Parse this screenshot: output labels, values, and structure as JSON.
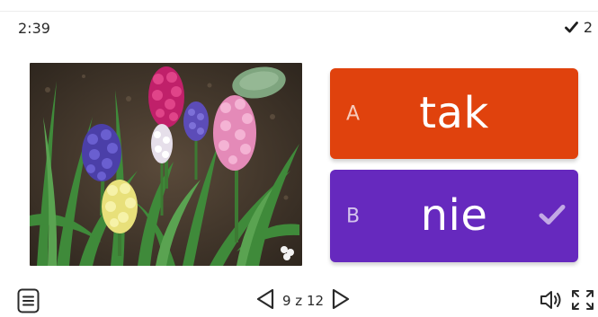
{
  "header": {
    "timer": "2:39",
    "score": "2",
    "score_icon": "check-icon"
  },
  "image": {
    "caption_left": "",
    "caption_right": ""
  },
  "answers": [
    {
      "letter": "A",
      "text": "tak",
      "color": "#e0420d",
      "selected": false
    },
    {
      "letter": "B",
      "text": "nie",
      "color": "#6629be",
      "selected": true,
      "mark_icon": "check-icon"
    }
  ],
  "footer": {
    "page_text": "9 z 12",
    "current_page": 9,
    "total_pages": 12,
    "icons": [
      "menu-icon",
      "prev-arrow-icon",
      "next-arrow-icon",
      "speaker-icon",
      "fullscreen-icon"
    ]
  }
}
